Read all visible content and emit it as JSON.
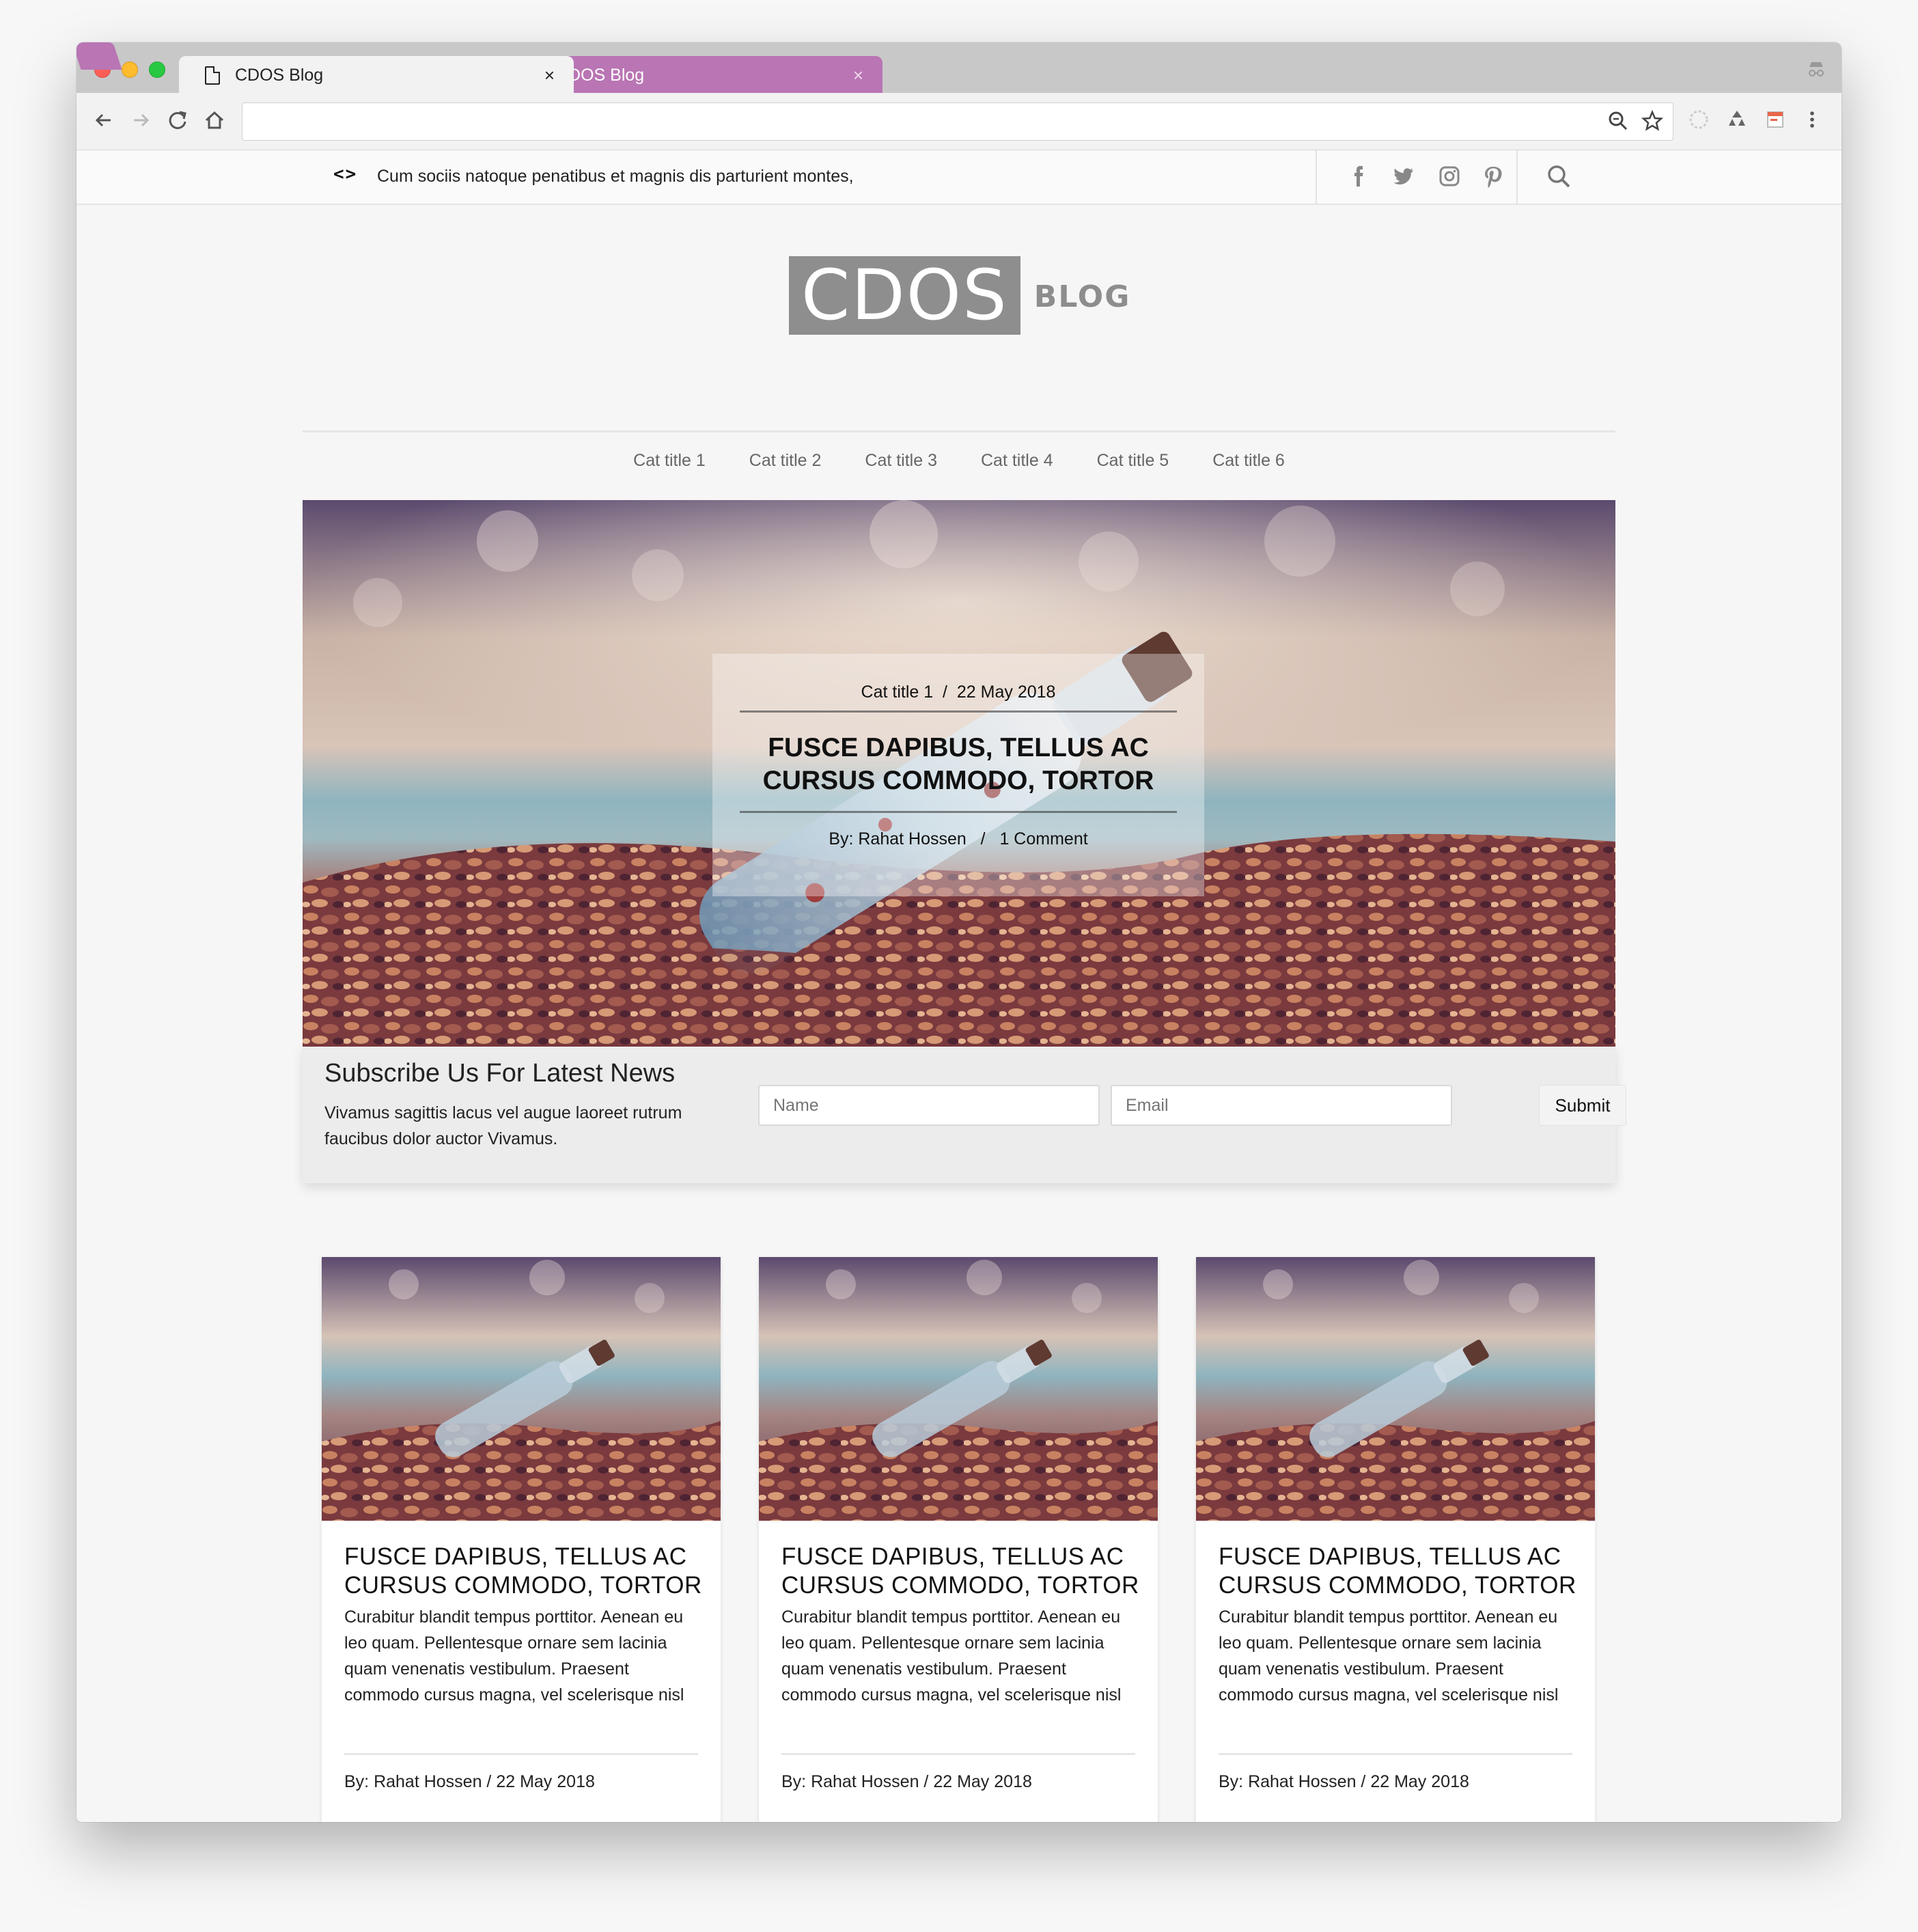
{
  "browser": {
    "tabs": [
      {
        "title": "CDOS Blog",
        "close": "×"
      },
      {
        "title": "CDOS Blog",
        "close": "×"
      }
    ]
  },
  "topbar": {
    "ticker_arrows": "<>",
    "ticker_text": "Cum sociis natoque penatibus et magnis dis parturient montes,"
  },
  "logo": {
    "main": "CDOS",
    "sub": "BLOG"
  },
  "menu": [
    "Cat title 1",
    "Cat title 2",
    "Cat title 3",
    "Cat title 4",
    "Cat title 5",
    "Cat title 6"
  ],
  "hero": {
    "category": "Cat title 1",
    "separator": "/",
    "date": "22 May 2018",
    "title": "FUSCE DAPIBUS, TELLUS AC CURSUS COMMODO, TORTOR",
    "author": "By: Rahat Hossen",
    "comments": "1 Comment"
  },
  "subscribe": {
    "title": "Subscribe Us For Latest News",
    "text": "Vivamus sagittis lacus vel augue laoreet rutrum faucibus dolor auctor Vivamus.",
    "name_placeholder": "Name",
    "email_placeholder": "Email",
    "submit_label": "Submit"
  },
  "cards": [
    {
      "title": "FUSCE DAPIBUS, TELLUS AC CURSUS COMMODO, TORTOR",
      "text": "Curabitur blandit tempus porttitor. Aenean eu leo quam. Pellentesque ornare sem lacinia quam venenatis vestibulum. Praesent commodo cursus magna, vel scelerisque nisl",
      "byline": "By: Rahat Hossen / 22 May 2018"
    },
    {
      "title": "FUSCE DAPIBUS, TELLUS AC CURSUS COMMODO, TORTOR",
      "text": "Curabitur blandit tempus porttitor. Aenean eu leo quam. Pellentesque ornare sem lacinia quam venenatis vestibulum. Praesent commodo cursus magna, vel scelerisque nisl",
      "byline": "By: Rahat Hossen / 22 May 2018"
    },
    {
      "title": "FUSCE DAPIBUS, TELLUS AC CURSUS COMMODO, TORTOR",
      "text": "Curabitur blandit tempus porttitor. Aenean eu leo quam. Pellentesque ornare sem lacinia quam venenatis vestibulum. Praesent commodo cursus magna, vel scelerisque nisl",
      "byline": "By: Rahat Hossen / 22 May 2018"
    }
  ],
  "colors": {
    "tab_accent": "#b975b4",
    "logo_gray": "#8e8e8e"
  },
  "icons": [
    "document-icon",
    "close-icon",
    "back-icon",
    "forward-icon",
    "reload-icon",
    "home-icon",
    "zoom-icon",
    "star-icon",
    "extension-icon",
    "recycle-icon",
    "menu-dots-icon",
    "facebook-icon",
    "twitter-icon",
    "instagram-icon",
    "pinterest-icon",
    "search-icon",
    "incognito-icon"
  ]
}
